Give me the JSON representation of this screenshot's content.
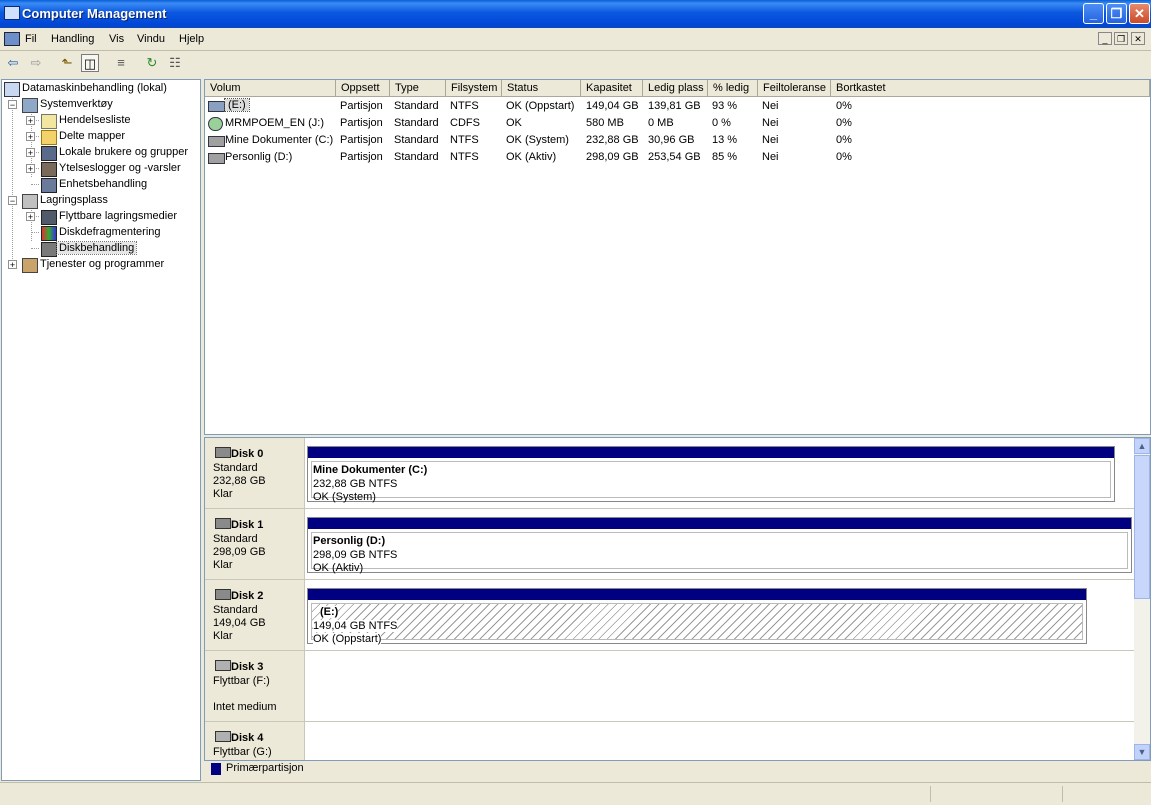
{
  "window": {
    "title": "Computer Management",
    "controls": [
      "_",
      "❐",
      "✕"
    ]
  },
  "menu": {
    "items": [
      "Fil",
      "Handling",
      "Vis",
      "Vindu",
      "Hjelp"
    ],
    "mdi_controls": [
      "_",
      "❐",
      "✕"
    ]
  },
  "toolbar": {
    "buttons": [
      "back-icon",
      "forward-icon",
      "up-folder-icon",
      "show-hide-tree-icon",
      "refresh-icon",
      "export-list-icon",
      "properties-icon"
    ]
  },
  "tree": {
    "root": "Datamaskinbehandling (lokal)",
    "items": [
      {
        "label": "Systemverktøy",
        "icon": "tools-icon"
      },
      {
        "label": "Hendelsesliste",
        "icon": "event-viewer-icon"
      },
      {
        "label": "Delte mapper",
        "icon": "shared-folder-icon"
      },
      {
        "label": "Lokale brukere og grupper",
        "icon": "users-icon"
      },
      {
        "label": "Ytelseslogger og -varsler",
        "icon": "performance-icon"
      },
      {
        "label": "Enhetsbehandling",
        "icon": "device-manager-icon"
      },
      {
        "label": "Lagringsplass",
        "icon": "storage-icon"
      },
      {
        "label": "Flyttbare lagringsmedier",
        "icon": "removable-storage-icon"
      },
      {
        "label": "Diskdefragmentering",
        "icon": "defrag-icon"
      },
      {
        "label": "Diskbehandling",
        "icon": "disk-management-icon"
      },
      {
        "label": "Tjenester og programmer",
        "icon": "services-icon"
      }
    ]
  },
  "volumes": {
    "columns": [
      "Volum",
      "Oppsett",
      "Type",
      "Filsystem",
      "Status",
      "Kapasitet",
      "Ledig plass",
      "% ledig",
      "Feiltoleranse",
      "Bortkastet"
    ],
    "rows": [
      [
        "(E:)",
        "Partisjon",
        "Standard",
        "NTFS",
        "OK (Oppstart)",
        "149,04 GB",
        "139,81 GB",
        "93 %",
        "Nei",
        "0%"
      ],
      [
        "MRMPOEM_EN (J:)",
        "Partisjon",
        "Standard",
        "CDFS",
        "OK",
        "580 MB",
        "0 MB",
        "0 %",
        "Nei",
        "0%"
      ],
      [
        "Mine Dokumenter (C:)",
        "Partisjon",
        "Standard",
        "NTFS",
        "OK (System)",
        "232,88 GB",
        "30,96 GB",
        "13 %",
        "Nei",
        "0%"
      ],
      [
        "Personlig (D:)",
        "Partisjon",
        "Standard",
        "NTFS",
        "OK (Aktiv)",
        "298,09 GB",
        "253,54 GB",
        "85 %",
        "Nei",
        "0%"
      ]
    ]
  },
  "disks": [
    {
      "name": "Disk 0",
      "type": "Standard",
      "size": "232,88 GB",
      "state": "Klar",
      "partition": {
        "name": "Mine Dokumenter  (C:)",
        "size": "232,88 GB NTFS",
        "status": "OK (System)"
      }
    },
    {
      "name": "Disk 1",
      "type": "Standard",
      "size": "298,09 GB",
      "state": "Klar",
      "partition": {
        "name": "Personlig  (D:)",
        "size": "298,09 GB NTFS",
        "status": "OK (Aktiv)"
      }
    },
    {
      "name": "Disk 2",
      "type": "Standard",
      "size": "149,04 GB",
      "state": "Klar",
      "partition": {
        "name": "(E:)",
        "size": "149,04 GB NTFS",
        "status": "OK (Oppstart)"
      }
    },
    {
      "name": "Disk 3",
      "type": "Flyttbar (F:)",
      "size": "",
      "state": "Intet medium"
    },
    {
      "name": "Disk 4",
      "type": "Flyttbar (G:)",
      "size": "",
      "state": ""
    }
  ],
  "legend": {
    "label": "Primærpartisjon",
    "color": "#000080"
  },
  "colors": {
    "titlebar": "#0054e3",
    "partition_bar": "#000080",
    "chrome": "#ece9d8"
  }
}
